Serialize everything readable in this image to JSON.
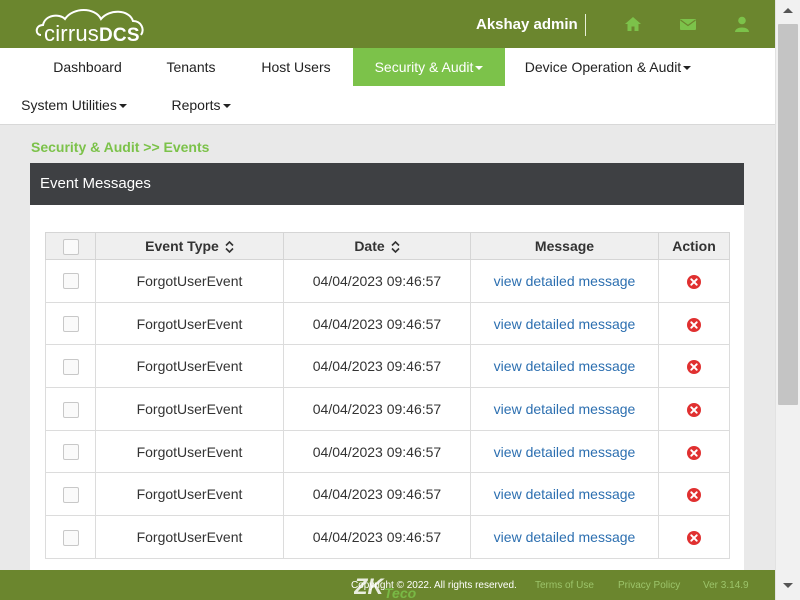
{
  "header": {
    "logo_part1": "cirrus",
    "logo_part2": "DCS",
    "user_name": "Akshay admin",
    "icons": [
      "home-icon",
      "envelope-icon",
      "user-icon"
    ]
  },
  "nav": {
    "items": [
      {
        "label": "Dashboard",
        "dropdown": false,
        "active": false
      },
      {
        "label": "Tenants",
        "dropdown": false,
        "active": false
      },
      {
        "label": "Host Users",
        "dropdown": false,
        "active": false
      },
      {
        "label": "Security & Audit",
        "dropdown": true,
        "active": true
      },
      {
        "label": "Device Operation & Audit",
        "dropdown": true,
        "active": false
      },
      {
        "label": "System Utilities",
        "dropdown": true,
        "active": false
      },
      {
        "label": "Reports",
        "dropdown": true,
        "active": false
      }
    ]
  },
  "breadcrumb": "Security & Audit >> Events",
  "panel": {
    "title": "Event Messages"
  },
  "table": {
    "columns": [
      "",
      "Event Type",
      "Date",
      "Message",
      "Action"
    ],
    "rows": [
      {
        "event_type": "ForgotUserEvent",
        "date": "04/04/2023 09:46:57",
        "message": "view detailed message"
      },
      {
        "event_type": "ForgotUserEvent",
        "date": "04/04/2023 09:46:57",
        "message": "view detailed message"
      },
      {
        "event_type": "ForgotUserEvent",
        "date": "04/04/2023 09:46:57",
        "message": "view detailed message"
      },
      {
        "event_type": "ForgotUserEvent",
        "date": "04/04/2023 09:46:57",
        "message": "view detailed message"
      },
      {
        "event_type": "ForgotUserEvent",
        "date": "04/04/2023 09:46:57",
        "message": "view detailed message"
      },
      {
        "event_type": "ForgotUserEvent",
        "date": "04/04/2023 09:46:57",
        "message": "view detailed message"
      },
      {
        "event_type": "ForgotUserEvent",
        "date": "04/04/2023 09:46:57",
        "message": "view detailed message"
      }
    ]
  },
  "footer": {
    "copyright": "Copyright © 2022. All rights reserved.",
    "terms": "Terms of Use",
    "privacy": "Privacy Policy",
    "version": "Ver 3.14.9",
    "logo": "ZKTeco"
  },
  "colors": {
    "header_bg": "#6b862e",
    "accent_green": "#7cc24a",
    "panel_header_bg": "#3e4043",
    "link_blue": "#2c6fb0",
    "delete_red": "#e03030"
  }
}
